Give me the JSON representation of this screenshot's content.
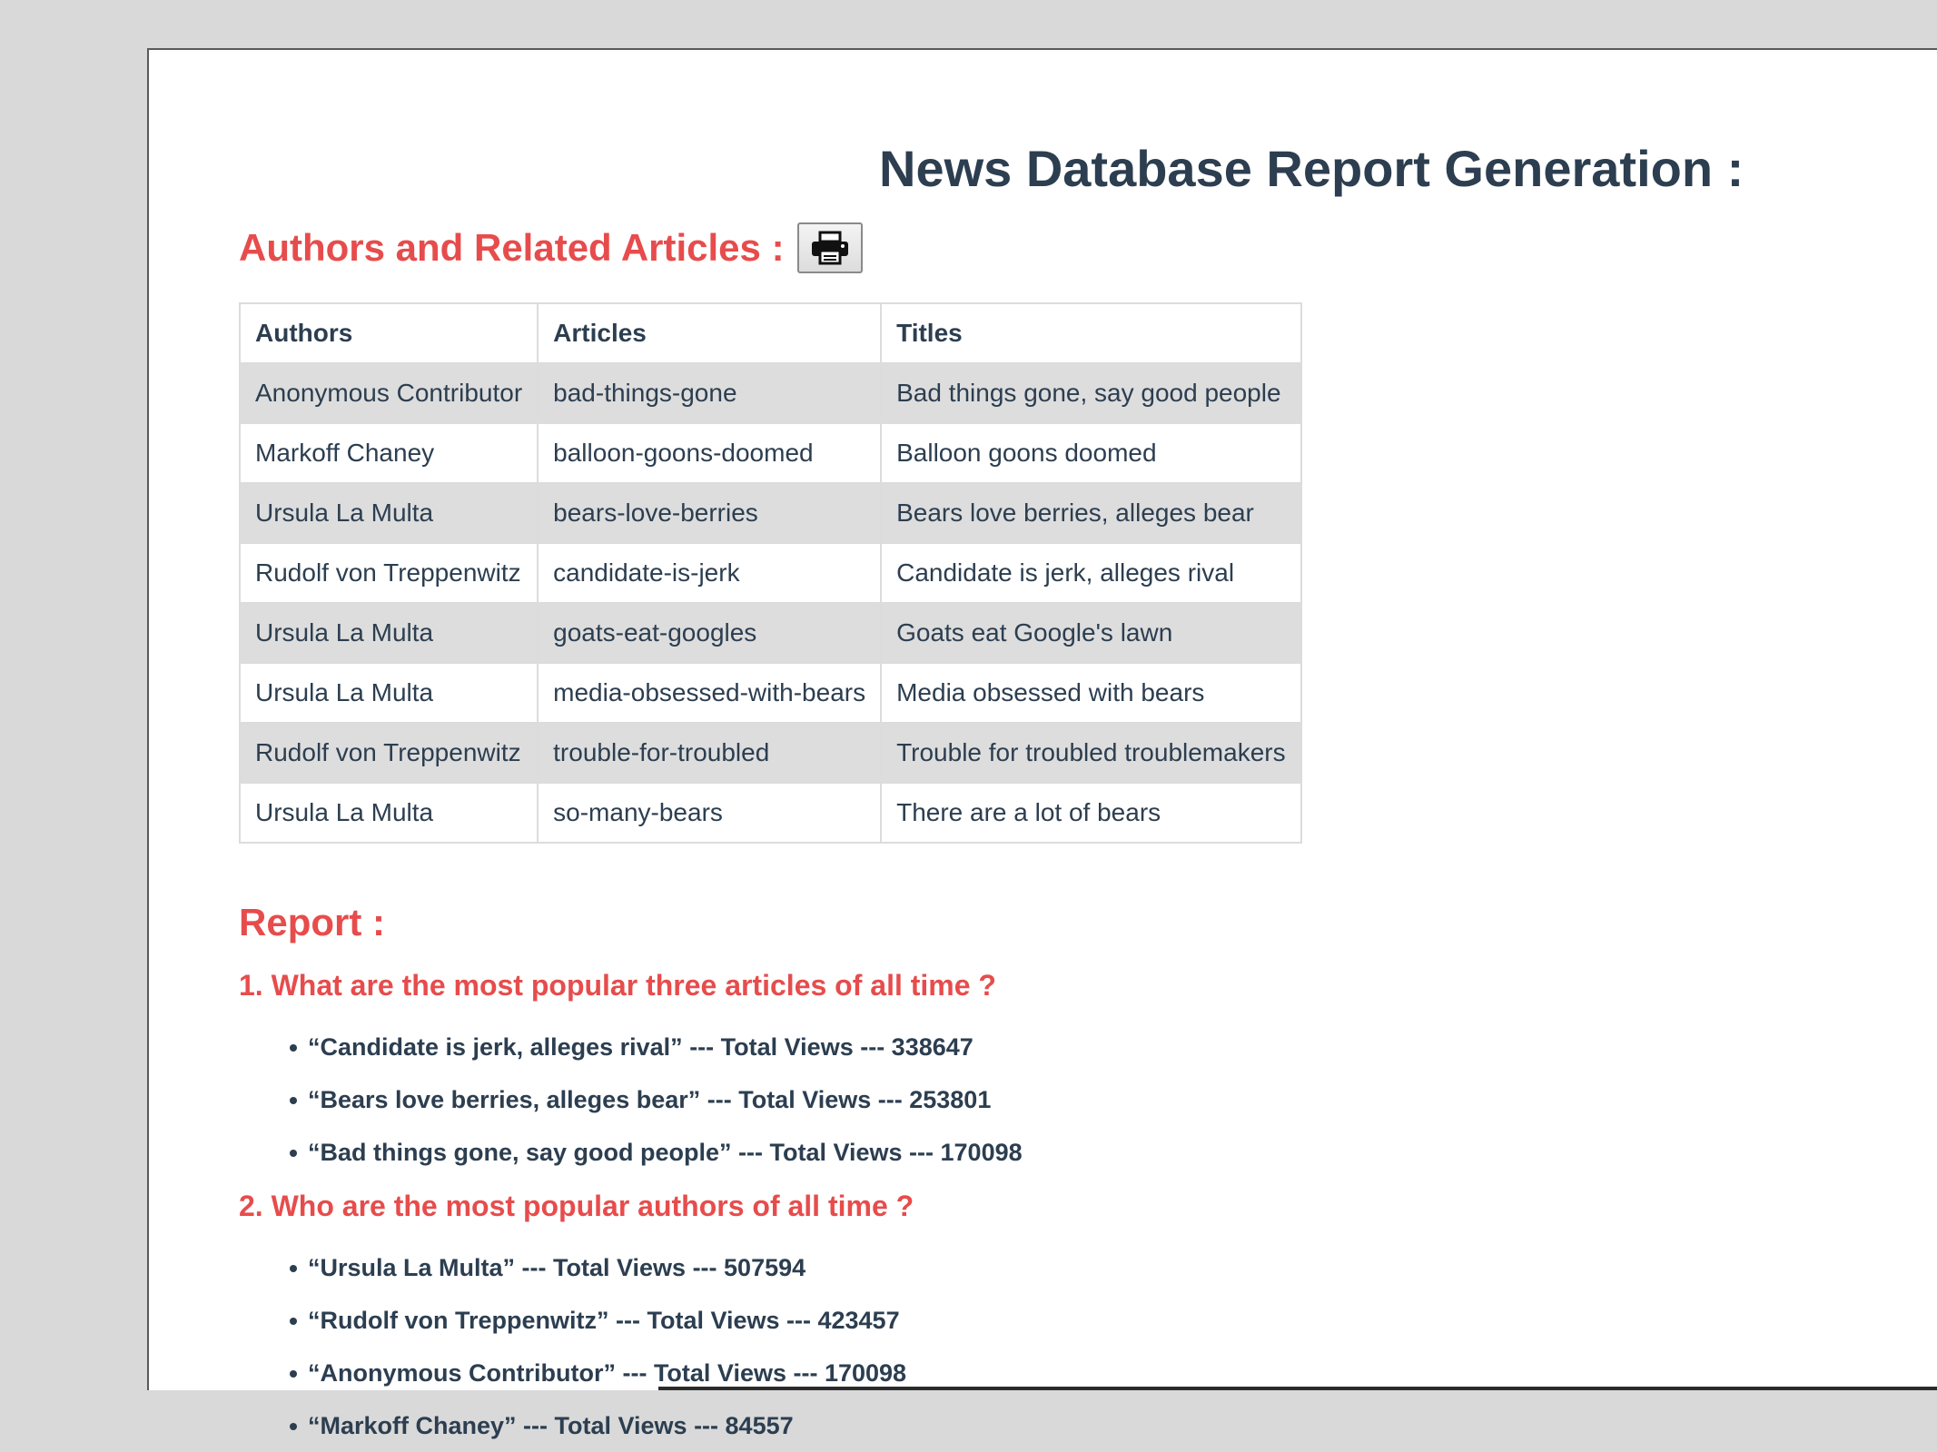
{
  "page": {
    "title": "News Database Report Generation :"
  },
  "section": {
    "title": "Authors and Related Articles :",
    "print_icon": "printer-icon"
  },
  "table": {
    "headers": [
      "Authors",
      "Articles",
      "Titles"
    ],
    "rows": [
      [
        "Anonymous Contributor",
        "bad-things-gone",
        "Bad things gone, say good people"
      ],
      [
        "Markoff Chaney",
        "balloon-goons-doomed",
        "Balloon goons doomed"
      ],
      [
        "Ursula La Multa",
        "bears-love-berries",
        "Bears love berries, alleges bear"
      ],
      [
        "Rudolf von Treppenwitz",
        "candidate-is-jerk",
        "Candidate is jerk, alleges rival"
      ],
      [
        "Ursula La Multa",
        "goats-eat-googles",
        "Goats eat Google's lawn"
      ],
      [
        "Ursula La Multa",
        "media-obsessed-with-bears",
        "Media obsessed with bears"
      ],
      [
        "Rudolf von Treppenwitz",
        "trouble-for-troubled",
        "Trouble for troubled troublemakers"
      ],
      [
        "Ursula La Multa",
        "so-many-bears",
        "There are a lot of bears"
      ]
    ]
  },
  "report": {
    "title": "Report :",
    "questions": [
      {
        "question": "1. What are the most popular three articles of all time ?",
        "answers": [
          "“Candidate is jerk, alleges rival” --- Total Views --- 338647",
          "“Bears love berries, alleges bear” --- Total Views --- 253801",
          "“Bad things gone, say good people” --- Total Views --- 170098"
        ]
      },
      {
        "question": "2. Who are the most popular authors of all time ?",
        "answers": [
          "“Ursula La Multa” --- Total Views --- 507594",
          "“Rudolf von Treppenwitz” --- Total Views --- 423457",
          "“Anonymous Contributor” --- Total Views --- 170098",
          "“Markoff Chaney” --- Total Views --- 84557"
        ]
      }
    ]
  },
  "colors": {
    "heading_accent": "#e74c4c",
    "text": "#2c3e50",
    "row_stripe": "#dddddd",
    "background": "#d9d9d9"
  }
}
